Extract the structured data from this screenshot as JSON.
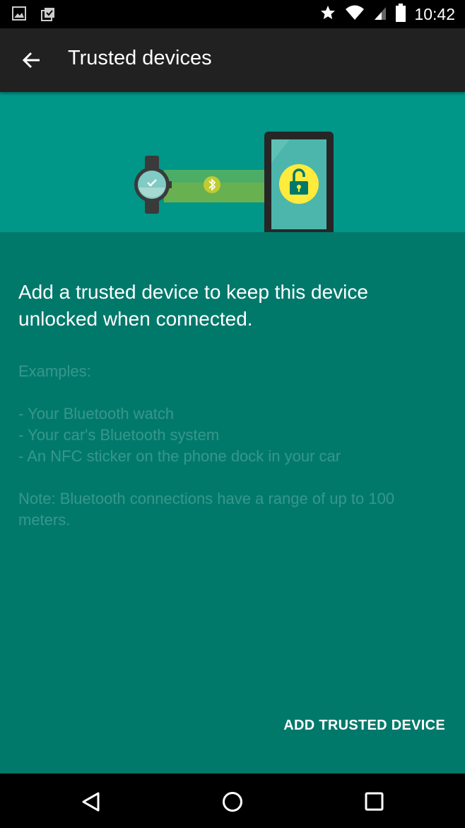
{
  "status_bar": {
    "time": "10:42",
    "left_icons": [
      "image-notification-icon",
      "clipboard-check-notification-icon"
    ],
    "right_icons": [
      "star-icon",
      "wifi-icon",
      "cell-signal-icon",
      "battery-icon"
    ]
  },
  "app_bar": {
    "title": "Trusted devices",
    "back_icon": "arrow-back-icon"
  },
  "hero": {
    "illustration": "smartwatch-bluetooth-unlocked-phone",
    "colors": {
      "background": "#009688",
      "beam": "#8bc34a",
      "lock_circle": "#ffeb3b",
      "screen": "#4db6ac"
    }
  },
  "content": {
    "headline": "Add a trusted device to keep this device unlocked when connected.",
    "examples_label": "Examples:",
    "examples": [
      "- Your Bluetooth watch",
      "- Your car's Bluetooth system",
      "- An NFC sticker on the phone dock in your car"
    ],
    "note": "Note: Bluetooth connections have a range of up to 100 meters."
  },
  "actions": {
    "add_trusted_device": "ADD TRUSTED DEVICE"
  },
  "nav_bar": {
    "buttons": [
      "back-triangle-icon",
      "home-circle-icon",
      "recents-square-icon"
    ]
  },
  "theme": {
    "primary_dark": "#00796b",
    "primary": "#009688",
    "app_bar": "#212121"
  }
}
